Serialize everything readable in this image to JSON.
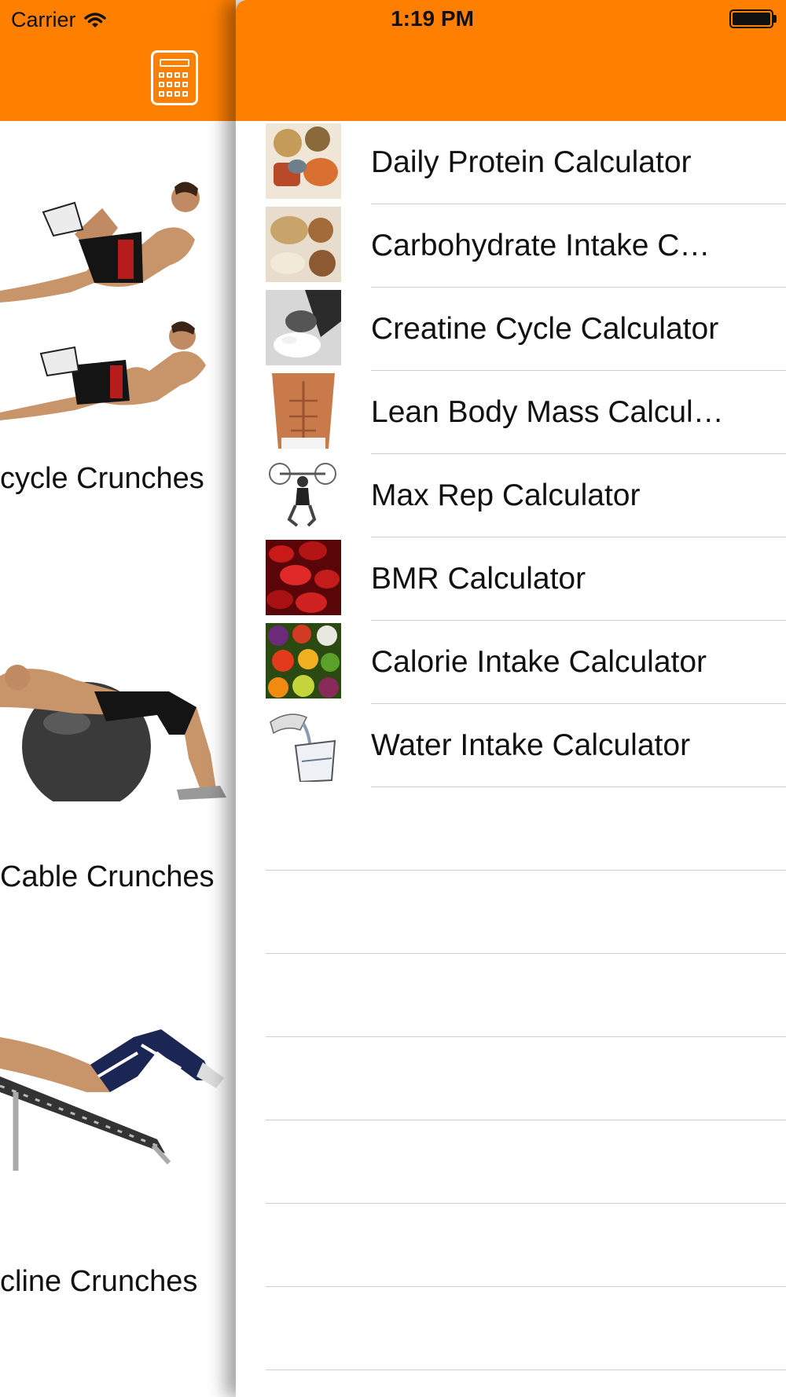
{
  "status_bar": {
    "carrier": "Carrier",
    "time": "1:19 PM",
    "battery_level": 1.0
  },
  "colors": {
    "header": "#ff8000",
    "separator": "#cfcfcf"
  },
  "left_panel": {
    "header_icon": "calculator-icon",
    "exercises": [
      {
        "label": "cycle Crunches",
        "image": "bicycle-crunch-photo"
      },
      {
        "label": "Cable Crunches",
        "image": "ball-crunch-photo"
      },
      {
        "label": "cline Crunches",
        "image": "incline-crunch-photo"
      }
    ]
  },
  "calculators": [
    {
      "label": "Daily Protein Calculator",
      "thumb": "protein-food-photo"
    },
    {
      "label": "Carbohydrate Intake C…",
      "thumb": "carbohydrate-food-photo"
    },
    {
      "label": "Creatine Cycle Calculator",
      "thumb": "creatine-scoop-photo"
    },
    {
      "label": "Lean Body Mass Calcul…",
      "thumb": "abs-torso-photo"
    },
    {
      "label": "Max Rep Calculator",
      "thumb": "squat-lifter-illustration"
    },
    {
      "label": "BMR Calculator",
      "thumb": "blood-cells-photo"
    },
    {
      "label": "Calorie Intake Calculator",
      "thumb": "fruits-vegetables-photo"
    },
    {
      "label": "Water Intake Calculator",
      "thumb": "water-glass-illustration"
    }
  ]
}
